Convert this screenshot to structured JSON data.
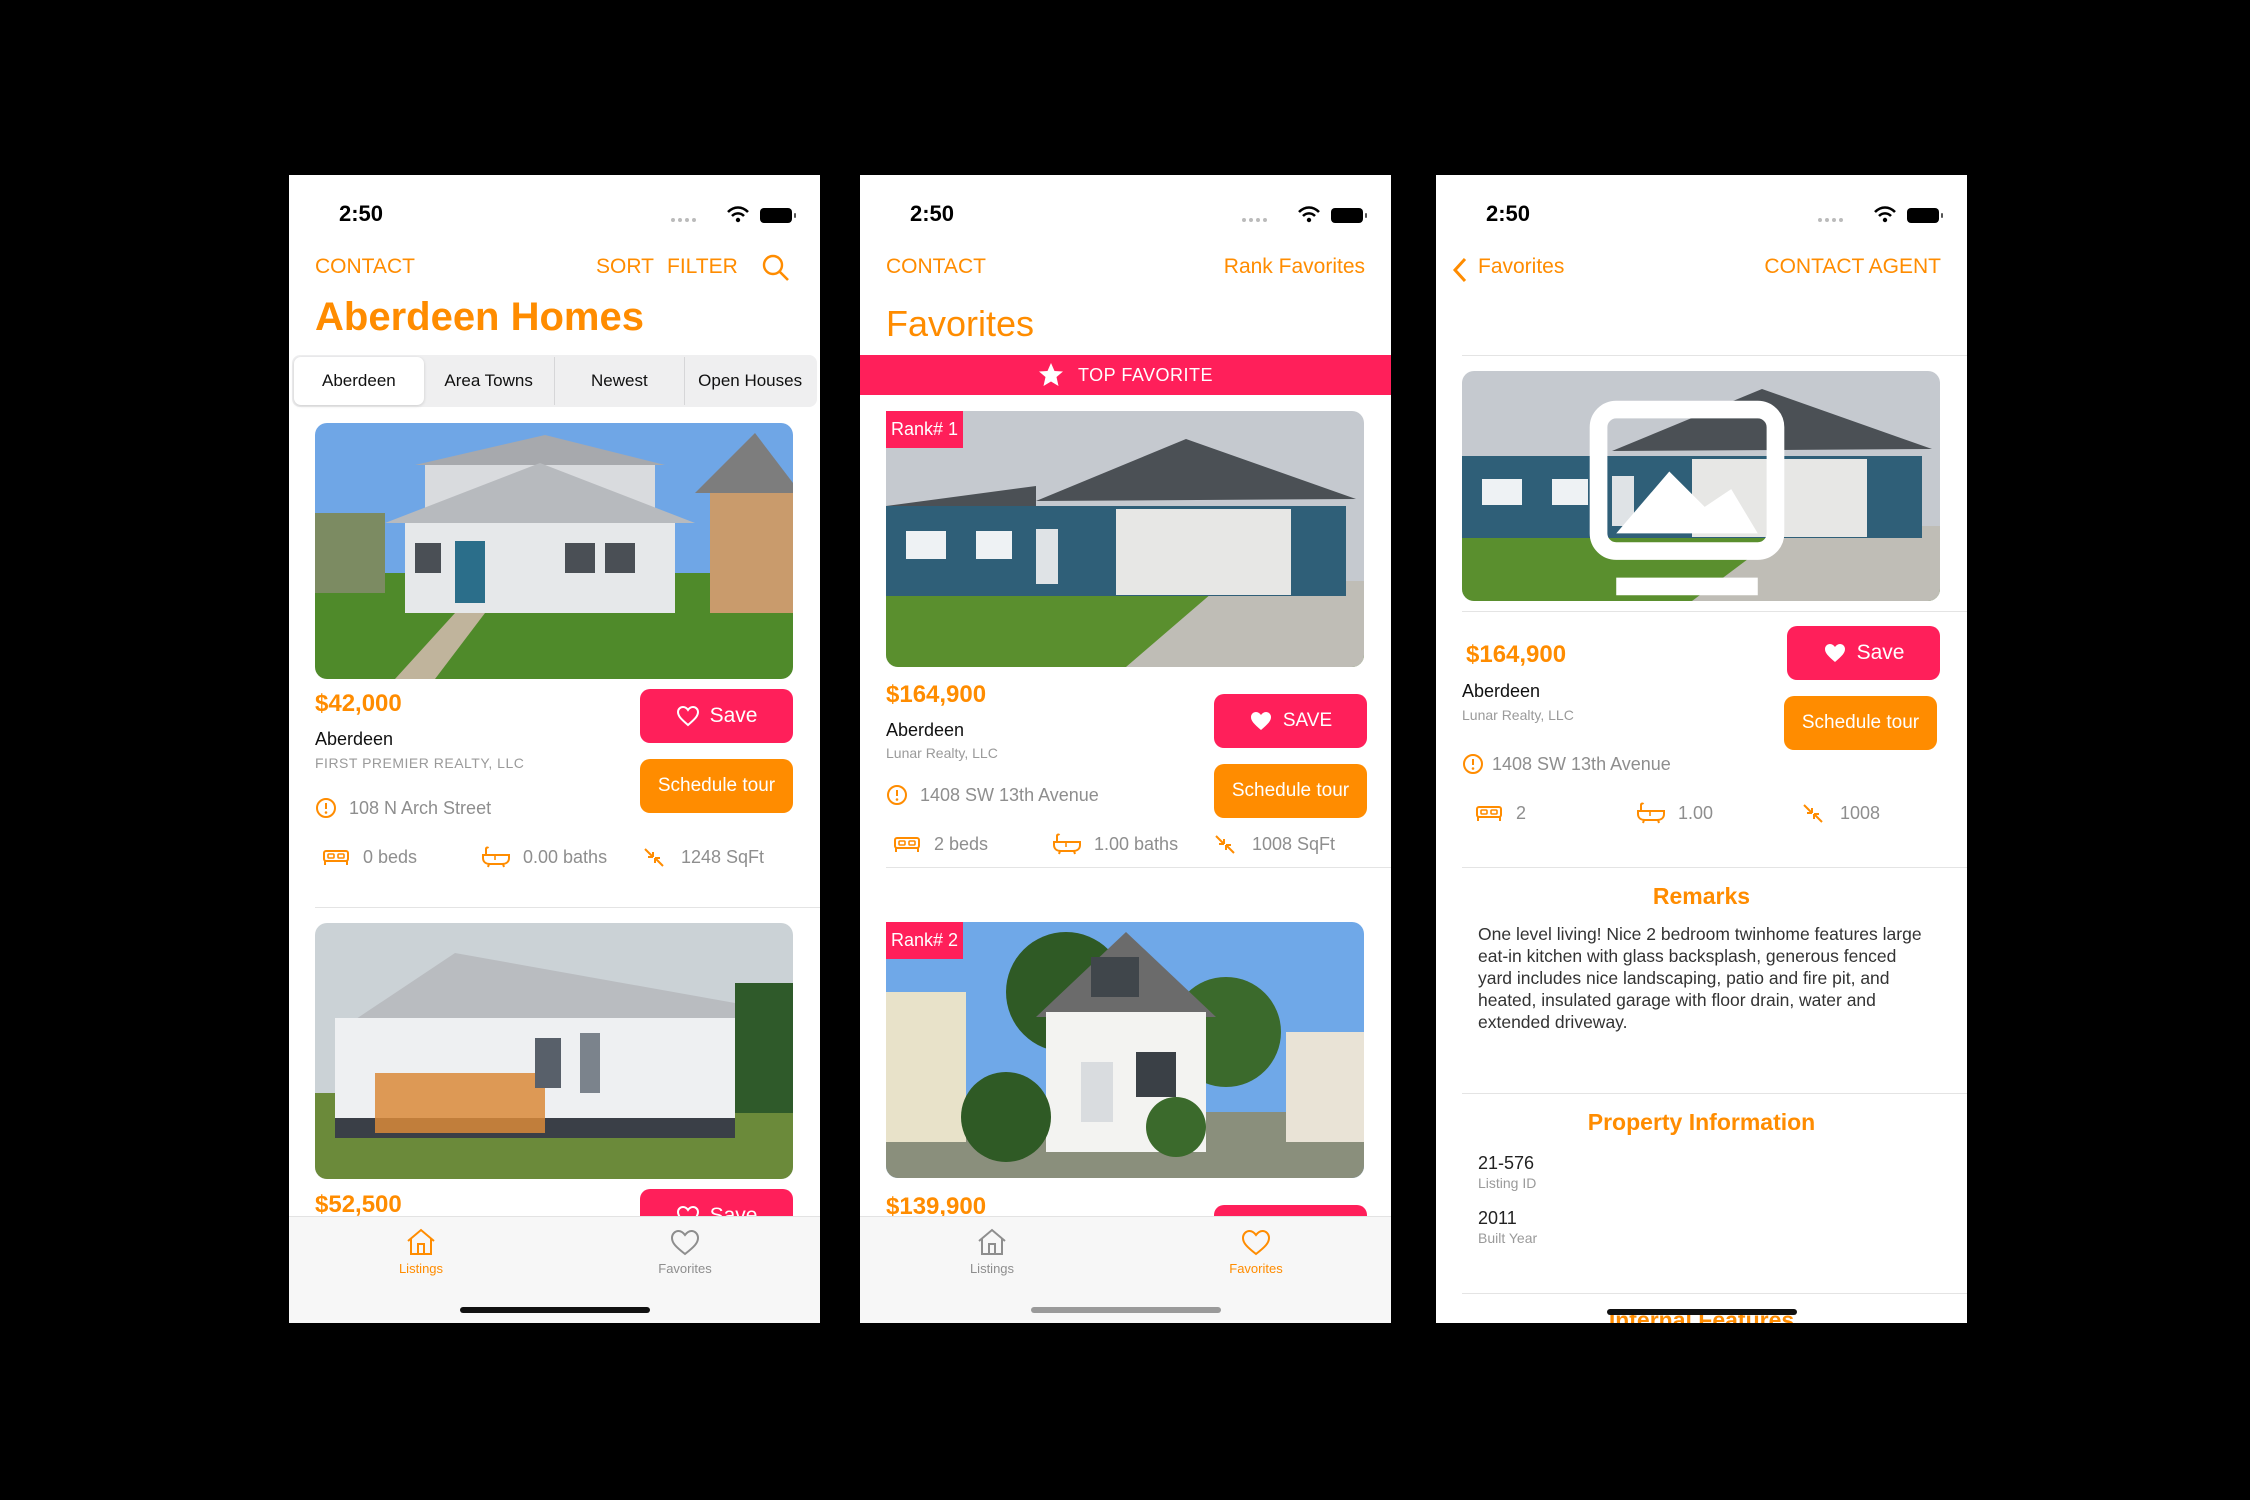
{
  "colors": {
    "accent": "#ff8c00",
    "pink": "#ff1f5a",
    "text": "#111111",
    "muted": "#8e8e8e"
  },
  "screens": [
    {
      "time": "2:50",
      "nav": {
        "contact": "CONTACT",
        "sort": "SORT",
        "filter": "FILTER"
      },
      "title": "Aberdeen Homes",
      "segments": [
        "Aberdeen",
        "Area Towns",
        "Newest",
        "Open Houses"
      ],
      "listings": [
        {
          "price": "$42,000",
          "city": "Aberdeen",
          "agency": "FIRST PREMIER REALTY, LLC",
          "address": "108 N Arch Street",
          "beds": "0 beds",
          "baths": "0.00 baths",
          "sqft": "1248 SqFt",
          "save": "Save",
          "tour": "Schedule tour"
        },
        {
          "price": "$52,500",
          "save": "Save"
        }
      ],
      "tabs": {
        "listings": "Listings",
        "favorites": "Favorites"
      }
    },
    {
      "time": "2:50",
      "nav": {
        "contact": "CONTACT",
        "rank": "Rank Favorites"
      },
      "title": "Favorites",
      "banner": "TOP FAVORITE",
      "favorites": [
        {
          "rank": "Rank# 1",
          "price": "$164,900",
          "city": "Aberdeen",
          "agency": "Lunar Realty, LLC",
          "address": "1408 SW 13th Avenue",
          "beds": "2 beds",
          "baths": "1.00 baths",
          "sqft": "1008 SqFt",
          "save": "SAVE",
          "tour": "Schedule tour"
        },
        {
          "rank": "Rank# 2",
          "price": "$139,900"
        }
      ],
      "tabs": {
        "listings": "Listings",
        "favorites": "Favorites"
      }
    },
    {
      "time": "2:50",
      "nav": {
        "back": "Favorites",
        "contact_agent": "CONTACT AGENT"
      },
      "price": "$164,900",
      "city": "Aberdeen",
      "agency": "Lunar Realty, LLC",
      "address": "1408 SW 13th Avenue",
      "beds": "2",
      "baths": "1.00",
      "sqft": "1008",
      "save": "Save",
      "tour": "Schedule tour",
      "remarks_title": "Remarks",
      "remarks": "One level living! Nice 2 bedroom twinhome features large eat-in kitchen with glass backsplash, generous fenced yard includes nice landscaping, patio and fire pit, and heated, insulated garage with floor drain, water and extended driveway.",
      "property_title": "Property Information",
      "listing_id": "21-576",
      "listing_id_label": "Listing ID",
      "built_year": "2011",
      "built_year_label": "Built Year",
      "next_section": "Internal Features"
    }
  ]
}
